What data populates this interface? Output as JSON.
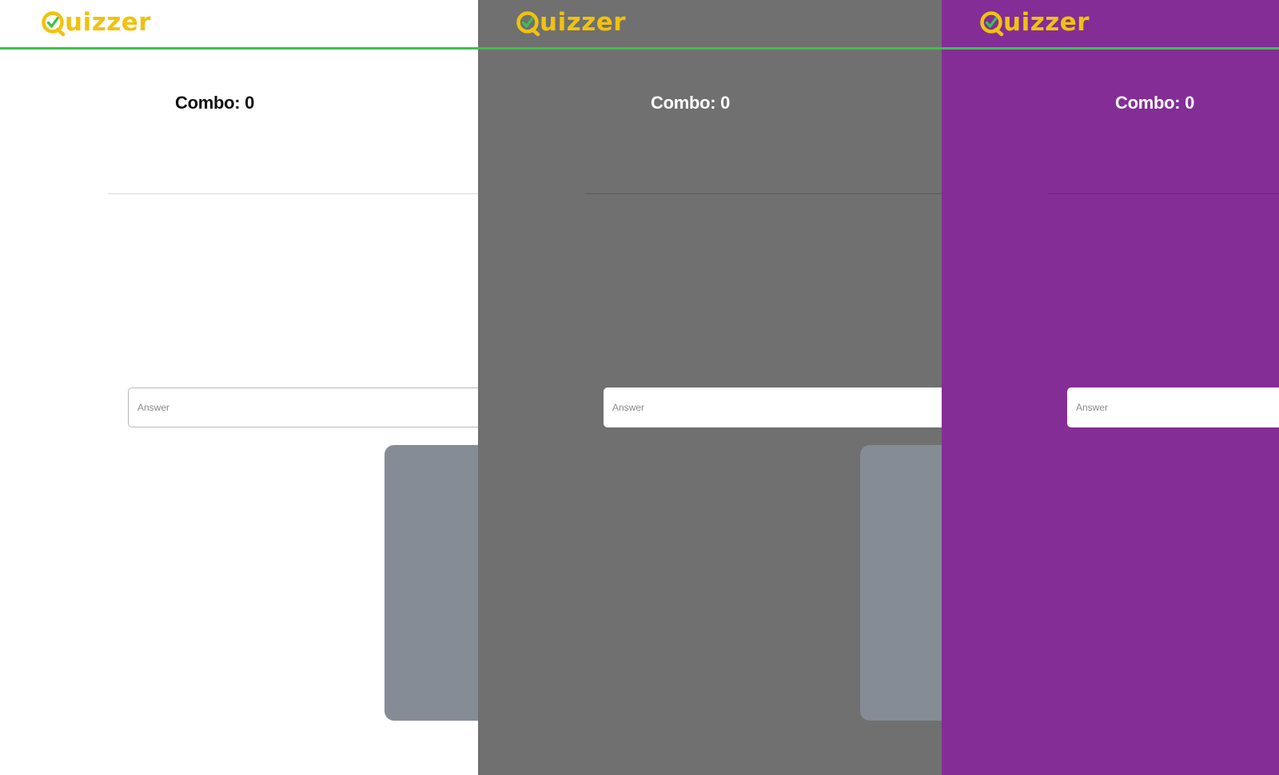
{
  "colors": {
    "accent_line": "#3fbf4f",
    "logo_yellow": "#f0c20f",
    "logo_check": "#3fbf4f",
    "card_gray": "#858c95"
  },
  "panels": [
    {
      "theme": "light",
      "background": "#ffffff",
      "logo": {
        "text": "uizzer",
        "icon": "q-check-icon"
      },
      "combo_label": "Combo: 0",
      "answer_placeholder": "Answer"
    },
    {
      "theme": "gray",
      "background": "#707070",
      "logo": {
        "text": "uizzer",
        "icon": "q-check-icon"
      },
      "combo_label": "Combo: 0",
      "answer_placeholder": "Answer"
    },
    {
      "theme": "purple",
      "background": "#842d97",
      "logo": {
        "text": "uizzer",
        "icon": "q-check-icon"
      },
      "combo_label": "Combo: 0",
      "answer_placeholder": "Answer"
    }
  ]
}
